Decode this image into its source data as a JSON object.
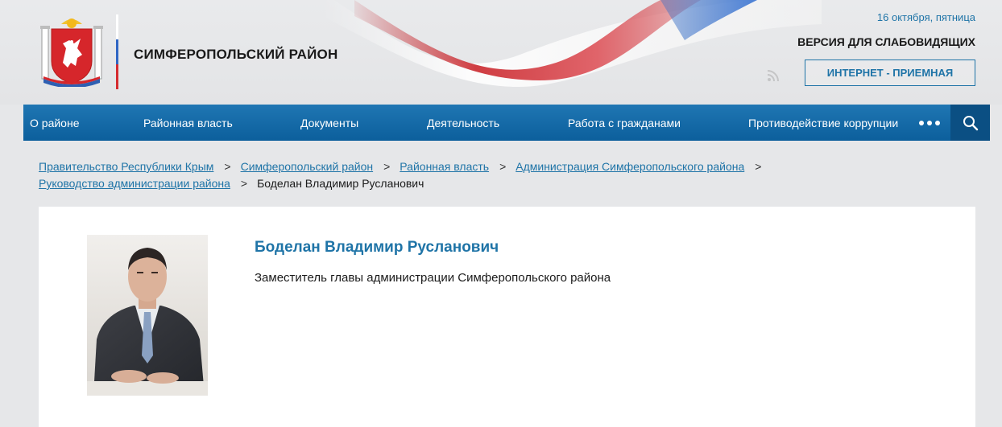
{
  "header": {
    "site_title": "СИМФЕРОПОЛЬСКИЙ РАЙОН",
    "date": "16 октября, пятница",
    "vision_link": "ВЕРСИЯ ДЛЯ СЛАБОВИДЯЩИХ",
    "reception_button": "ИНТЕРНЕТ - ПРИЕМНАЯ",
    "logo_icon": "crimea-coat-of-arms-icon",
    "rss_icon": "rss-icon"
  },
  "nav": {
    "items": [
      {
        "label": "О районе"
      },
      {
        "label": "Районная власть"
      },
      {
        "label": "Документы"
      },
      {
        "label": "Деятельность"
      },
      {
        "label": "Работа с гражданами"
      },
      {
        "label": "Противодействие коррупции"
      }
    ],
    "more_icon": "more-dots-icon",
    "search_icon": "search-icon"
  },
  "breadcrumb": {
    "links": [
      "Правительство Республики Крым",
      "Симферопольский район",
      "Районная власть",
      "Администрация Симферопольского района",
      "Руководство администрации района"
    ],
    "separator": ">",
    "current": "Боделан Владимир Русланович"
  },
  "person": {
    "name": "Боделан Владимир Русланович",
    "position": "Заместитель главы администрации Симферопольского района"
  },
  "colors": {
    "accent": "#1f74a7",
    "nav_bg": "#0f65a3",
    "nav_search_bg": "#0b4f83",
    "page_bg": "#e6e7e9",
    "card_bg": "#ffffff"
  }
}
